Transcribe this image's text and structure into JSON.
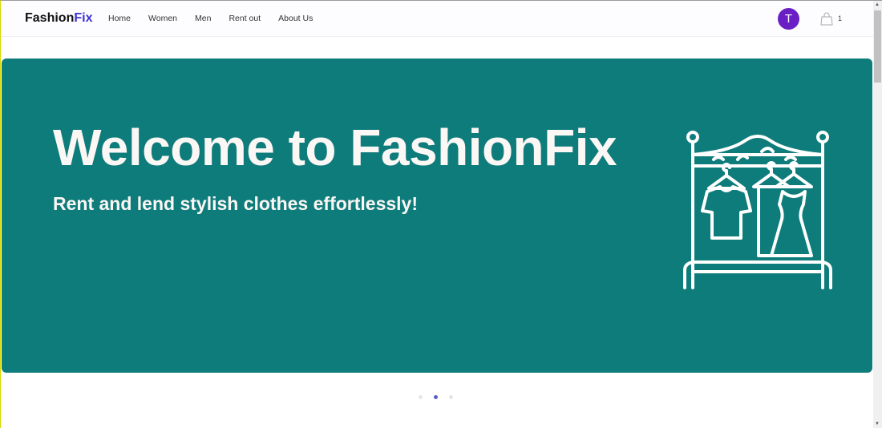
{
  "nav": {
    "logo_part1": "Fashion",
    "logo_part2": "Fix",
    "links": [
      "Home",
      "Women",
      "Men",
      "Rent out",
      "About Us"
    ],
    "avatar_initial": "T",
    "cart_count": "1"
  },
  "hero": {
    "title": "Welcome to FashionFix",
    "subtitle": "Rent and lend stylish clothes effortlessly!",
    "icon": "clothes-rack-icon"
  },
  "carousel": {
    "slide_count": 3,
    "active_index": 1
  },
  "colors": {
    "banner": "#0e7c7b",
    "brand_accent": "#3b2fd8",
    "avatar": "#6a1fc4"
  }
}
